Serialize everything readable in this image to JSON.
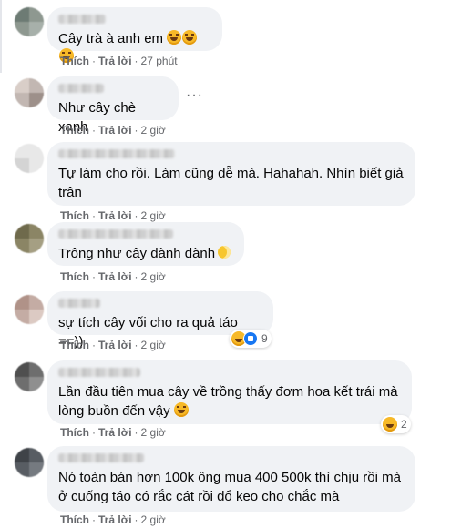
{
  "comments": [
    {
      "text": "Cây trà à anh em",
      "emojis": [
        "rolling-laughing-emoji",
        "rolling-laughing-emoji",
        "rolling-laughing-emoji"
      ],
      "actions": {
        "like": "Thích",
        "reply": "Trả lời",
        "time": "27 phút"
      }
    },
    {
      "text": "Như cây chè xanh",
      "actions": {
        "like": "Thích",
        "reply": "Trả lời",
        "time": "2 giờ"
      },
      "more": "···"
    },
    {
      "text": "Tự làm cho rồi. Làm cũng dễ mà. Hahahah. Nhìn biết giả\ntrân",
      "actions": {
        "like": "Thích",
        "reply": "Trả lời",
        "time": "2 giờ"
      }
    },
    {
      "text": "Trông như cây dành dành",
      "emojis": [
        "moon-face-emoji"
      ],
      "actions": {
        "like": "Thích",
        "reply": "Trả lời",
        "time": "2 giờ"
      }
    },
    {
      "text": "sự tích cây vối cho ra quả táo ==))",
      "actions": {
        "like": "Thích",
        "reply": "Trả lời",
        "time": "2 giờ"
      },
      "reactions": {
        "icons": [
          "haha-icon",
          "like-icon"
        ],
        "count": "9"
      }
    },
    {
      "text": "Lần đầu tiên mua cây về trồng thấy đơm hoa kết trái mà\nlòng buồn đến vậy",
      "emojis": [
        "rolling-laughing-emoji"
      ],
      "actions": {
        "like": "Thích",
        "reply": "Trả lời",
        "time": "2 giờ"
      },
      "reactions": {
        "icons": [
          "haha-icon"
        ],
        "count": "2"
      }
    },
    {
      "text": "Nó toàn bán hơn 100k ông mua 400 500k thì chịu rồi mà\nở cuống táo có rắc cát rồi đổ keo cho chắc mà",
      "actions": {
        "like": "Thích",
        "reply": "Trả lời",
        "time": "2 giờ"
      }
    }
  ],
  "colors": {
    "bubble": "#f0f2f5",
    "text": "#050505",
    "meta": "#65676b",
    "like_blue": "#1877f2",
    "haha_yellow": "#f7b928"
  }
}
